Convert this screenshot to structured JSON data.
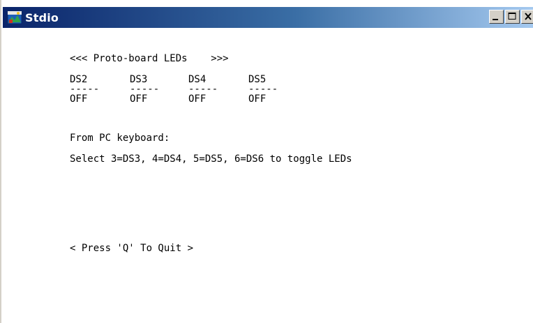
{
  "window": {
    "title": "Stdio",
    "controls": [
      "minimize-icon",
      "maximize-icon",
      "close-icon"
    ]
  },
  "console": {
    "header": "<<< Proto-board LEDs    >>>",
    "leds": [
      {
        "name": "DS2",
        "separator": "-----",
        "state": "OFF"
      },
      {
        "name": "DS3",
        "separator": "-----",
        "state": "OFF"
      },
      {
        "name": "DS4",
        "separator": "-----",
        "state": "OFF"
      },
      {
        "name": "DS5",
        "separator": "-----",
        "state": "OFF"
      }
    ],
    "keyboard_label": "From PC keyboard:",
    "instruction": "Select 3=DS3, 4=DS4, 5=DS5, 6=DS6 to toggle LEDs",
    "quit_prompt": "< Press 'Q' To Quit >"
  }
}
